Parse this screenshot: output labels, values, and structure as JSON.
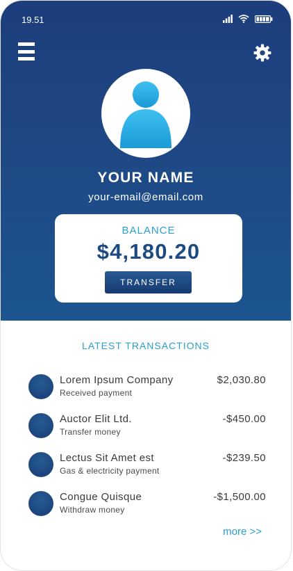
{
  "status": {
    "time": "19.51"
  },
  "profile": {
    "name": "YOUR NAME",
    "email": "your-email@email.com"
  },
  "balance": {
    "label": "BALANCE",
    "amount": "$4,180.20",
    "transfer_label": "TRANSFER"
  },
  "transactions": {
    "title": "LATEST TRANSACTIONS",
    "items": [
      {
        "name": "Lorem Ipsum Company",
        "desc": "Received payment",
        "amount": "$2,030.80"
      },
      {
        "name": "Auctor Elit Ltd.",
        "desc": "Transfer money",
        "amount": "-$450.00"
      },
      {
        "name": "Lectus Sit Amet est",
        "desc": "Gas & electricity payment",
        "amount": "-$239.50"
      },
      {
        "name": "Congue Quisque",
        "desc": "Withdraw money",
        "amount": "-$1,500.00"
      }
    ],
    "more_label": "more >>"
  },
  "icons": {
    "menu": "hamburger-menu-icon",
    "settings": "gear-icon",
    "avatar": "user-avatar-icon",
    "signal": "signal-icon",
    "wifi": "wifi-icon",
    "battery": "battery-icon"
  },
  "colors": {
    "header_top": "#1d3d7c",
    "header_bottom": "#1c5590",
    "accent": "#2a9fcd",
    "balance_text": "#1d4a82",
    "transaction_dot": "#1e4a86"
  }
}
